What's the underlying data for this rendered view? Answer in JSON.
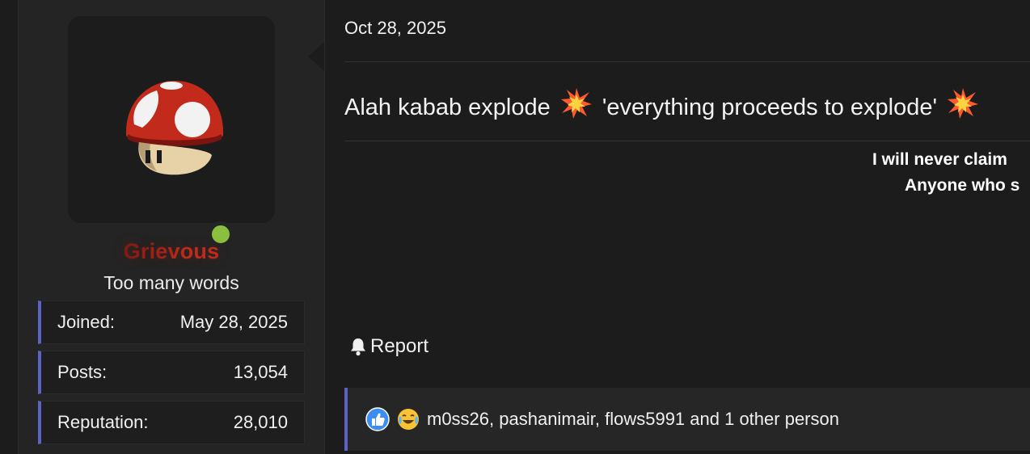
{
  "user": {
    "name": "Grievous",
    "title": "Too many words",
    "online": true,
    "stats": [
      {
        "label": "Joined:",
        "value": "May 28, 2025"
      },
      {
        "label": "Posts:",
        "value": "13,054"
      },
      {
        "label": "Reputation:",
        "value": "28,010"
      }
    ]
  },
  "post": {
    "date": "Oct 28, 2025",
    "text_part1": "Alah kabab explode",
    "text_part2": "'everything proceeds to explode'",
    "emoji": "collision-emoji",
    "signature_lines": [
      "I will never claim",
      "Anyone who s"
    ],
    "report_label": "Report"
  },
  "reactions": {
    "icons": [
      "like-icon",
      "laugh-cry-icon"
    ],
    "text": "m0ss26, pashanimair, flows5991 and 1 other person"
  },
  "colors": {
    "accent": "#5d63c4",
    "online": "#8bbf3f",
    "username_red": "#c2321f"
  }
}
